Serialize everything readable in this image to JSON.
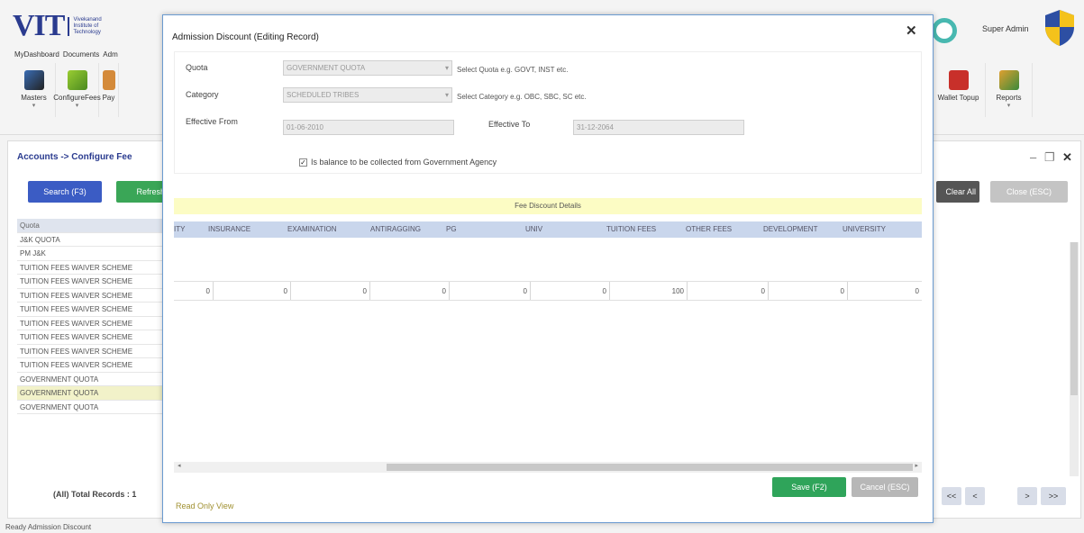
{
  "app": {
    "logo_text": "VIT",
    "logo_subtext": "Vivekanand Institute of Technology",
    "user_name": "Super Admin",
    "menu": [
      "MyDashboard",
      "Documents",
      "Adm"
    ],
    "ribbon": [
      {
        "label": "Masters",
        "icon": "masters-icon"
      },
      {
        "label": "ConfigureFees",
        "icon": "configure-fees-icon"
      },
      {
        "label": "Pay",
        "icon": "pay-icon"
      }
    ],
    "ribbon_right": [
      {
        "label": "Wallet Topup",
        "icon": "wallet-icon"
      },
      {
        "label": "Reports",
        "icon": "reports-icon"
      }
    ]
  },
  "panel": {
    "title": "Accounts -> Configure Fee",
    "search_btn": "Search (F3)",
    "refresh_btn": "Refresh",
    "clear_all_btn": "Clear All",
    "close_btn": "Close (ESC)",
    "list_header": "Quota",
    "list_items": [
      "J&K QUOTA",
      "PM J&K",
      "TUITION FEES WAIVER SCHEME",
      "TUITION FEES WAIVER SCHEME",
      "TUITION FEES WAIVER SCHEME",
      "TUITION FEES WAIVER SCHEME",
      "TUITION FEES WAIVER SCHEME",
      "TUITION FEES WAIVER SCHEME",
      "TUITION FEES WAIVER SCHEME",
      "TUITION FEES WAIVER SCHEME",
      "GOVERNMENT QUOTA",
      "GOVERNMENT QUOTA",
      "GOVERNMENT QUOTA"
    ],
    "selected_index": 11,
    "total_records": "(All) Total Records : 1",
    "pager": [
      "<<",
      "<",
      ">",
      ">>"
    ]
  },
  "status_bar": "Ready  Admission Discount",
  "modal": {
    "title": "Admission Discount (Editing Record)",
    "quota_label": "Quota",
    "quota_value": "GOVERNMENT QUOTA",
    "quota_hint": "Select Quota e.g. GOVT, INST etc.",
    "category_label": "Category",
    "category_value": "SCHEDULED TRIBES",
    "category_hint": "Select Category e.g. OBC, SBC, SC etc.",
    "effective_from_label": "Effective From",
    "effective_from_value": "01-06-2010",
    "effective_to_label": "Effective To",
    "effective_to_value": "31-12-2064",
    "checkbox_label": "Is balance to be collected from Government Agency",
    "checkbox_checked": true,
    "grid_title": "Fee Discount Details",
    "columns": [
      "ITY",
      "INSURANCE",
      "EXAMINATION",
      "ANTIRAGGING",
      "PG",
      "UNIV",
      "TUITION FEES",
      "OTHER FEES",
      "DEVELOPMENT",
      "UNIVERSITY"
    ],
    "row_values": [
      "0",
      "0",
      "0",
      "0",
      "0",
      "0",
      "100",
      "0",
      "0",
      "0"
    ],
    "save_btn": "Save (F2)",
    "cancel_btn": "Cancel (ESC)",
    "readonly_text": "Read Only View"
  },
  "colors": {
    "search": "#3b5cc4",
    "refresh": "#3aa657",
    "save": "#2fa45a",
    "cancel": "#b7b7b7",
    "grid_band": "#fcfcc4",
    "grid_header": "#c9d6ec"
  }
}
